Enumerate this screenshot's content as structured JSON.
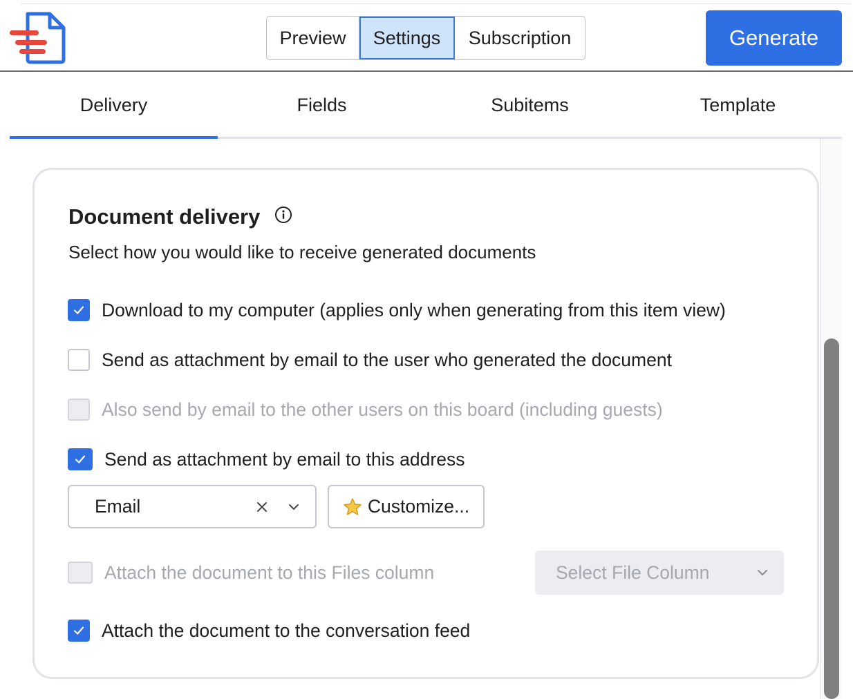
{
  "header": {
    "logo_icon": "document-lines-logo-icon",
    "segments": [
      {
        "label": "Preview",
        "selected": false
      },
      {
        "label": "Settings",
        "selected": true
      },
      {
        "label": "Subscription",
        "selected": false
      }
    ],
    "generate_label": "Generate"
  },
  "tabs": [
    {
      "label": "Delivery",
      "active": true
    },
    {
      "label": "Fields",
      "active": false
    },
    {
      "label": "Subitems",
      "active": false
    },
    {
      "label": "Template",
      "active": false
    }
  ],
  "delivery": {
    "title": "Document delivery",
    "subtitle": "Select how you would like to receive generated documents",
    "options": {
      "download": {
        "label": "Download to my computer (applies only when generating from this item view)",
        "checked": true,
        "disabled": false
      },
      "email_user": {
        "label": "Send as attachment by email to the user who generated the document",
        "checked": false,
        "disabled": false
      },
      "email_board": {
        "label": "Also send by email to the other users on this board (including guests)",
        "checked": false,
        "disabled": true
      },
      "email_address": {
        "label": "Send as attachment by email to this address",
        "checked": true,
        "disabled": false
      },
      "files_column": {
        "label": "Attach the document to this Files column",
        "checked": false,
        "disabled": true
      },
      "conversation": {
        "label": "Attach the document to the conversation feed",
        "checked": true,
        "disabled": false
      }
    },
    "email_select": {
      "value": "Email"
    },
    "customize_label": "Customize...",
    "file_column_select": {
      "placeholder": "Select File Column"
    }
  },
  "colors": {
    "accent": "#2e6fe3",
    "brand_red": "#e8453c",
    "selected_segment": "#cfe3fb",
    "muted_text": "#a6a8b0"
  }
}
